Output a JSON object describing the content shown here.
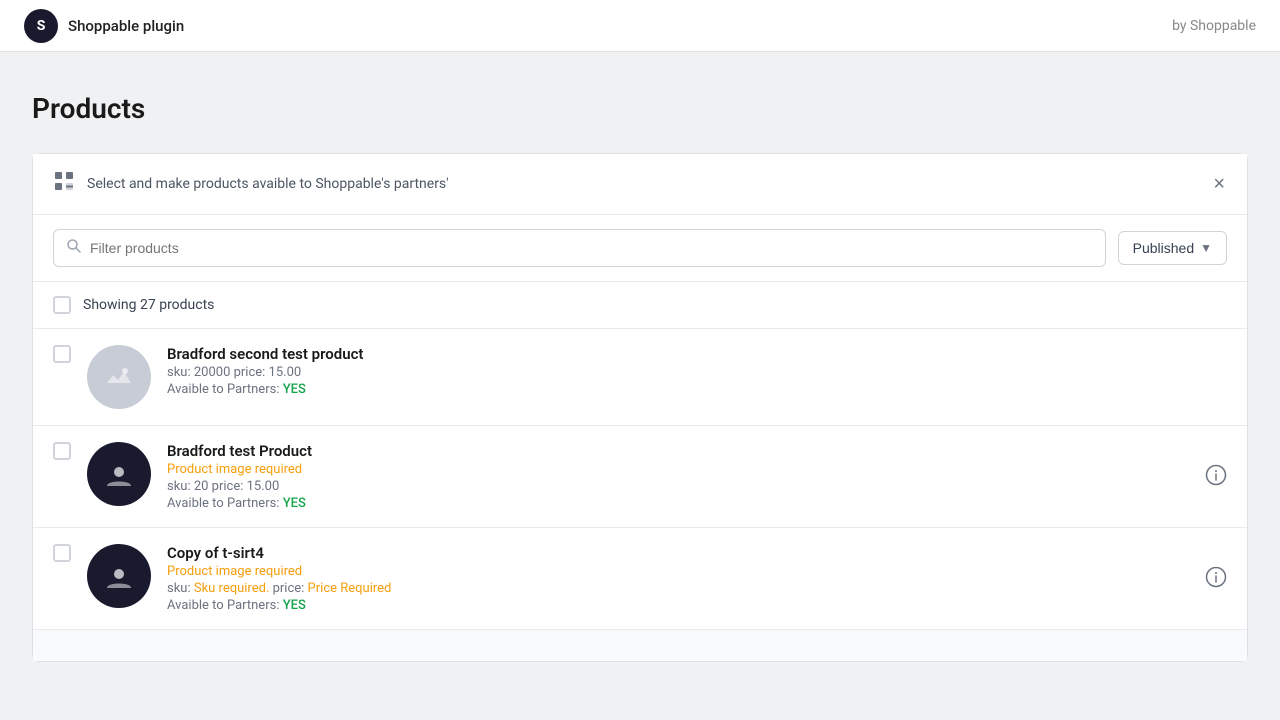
{
  "topbar": {
    "brand_initial": "S",
    "brand_name": "Shoppable plugin",
    "byline": "by Shoppable"
  },
  "page": {
    "title": "Products"
  },
  "banner": {
    "text": "Select and make products avaible to Shoppable's partners'",
    "close_label": "×"
  },
  "search": {
    "placeholder": "Filter products",
    "filter_label": "Published",
    "chevron": "▼"
  },
  "showing": {
    "text": "Showing 27 products"
  },
  "products": [
    {
      "id": "p1",
      "name": "Bradford second test product",
      "warning": null,
      "sku": "sku: 20000",
      "price": "price: 15.00",
      "partners": "YES",
      "thumb_style": "gray",
      "has_info": false
    },
    {
      "id": "p2",
      "name": "Bradford test Product",
      "warning": "Product image required",
      "sku": "sku: 20",
      "price": "price: 15.00",
      "partners": "YES",
      "thumb_style": "dark",
      "has_info": true,
      "sku_required": false,
      "price_required": false
    },
    {
      "id": "p3",
      "name": "Copy of t-sirt4",
      "warning": "Product image required",
      "sku_label": "sku: ",
      "sku_required_text": "Sku required.",
      "price_label": " price: ",
      "price_required_text": "Price Required",
      "partners": "YES",
      "thumb_style": "dark",
      "has_info": true
    }
  ],
  "labels": {
    "avaible_to_partners": "Avaible to Partners:",
    "sku_prefix": "sku:",
    "price_prefix": "price:"
  }
}
